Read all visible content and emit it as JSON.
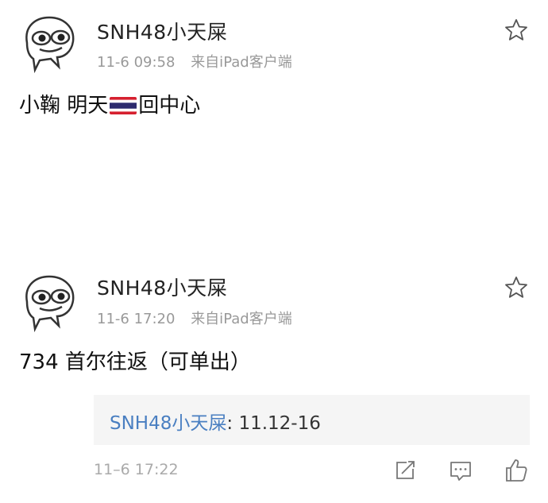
{
  "posts": [
    {
      "username": "SNH48小天屎",
      "time": "11-6 09:58",
      "source": "来自iPad客户端",
      "content_before": "小鞠 明天",
      "flag_icon": "thailand-flag-icon",
      "content_after": "回中心"
    },
    {
      "username": "SNH48小天屎",
      "time": "11-6 17:20",
      "source": "来自iPad客户端",
      "content": "734 首尔往返（可单出）",
      "reply": {
        "user": "SNH48小天屎",
        "separator": ": ",
        "text": "11.12-16"
      },
      "footer_time": "11–6 17:22"
    }
  ],
  "icons": {
    "favorite": "star-outline-icon",
    "share": "share-icon",
    "comment": "comment-icon",
    "like": "thumbs-up-icon"
  },
  "colors": {
    "reply_user": "#4a7fc1",
    "meta": "#999999",
    "reply_bg": "#f5f5f5"
  }
}
